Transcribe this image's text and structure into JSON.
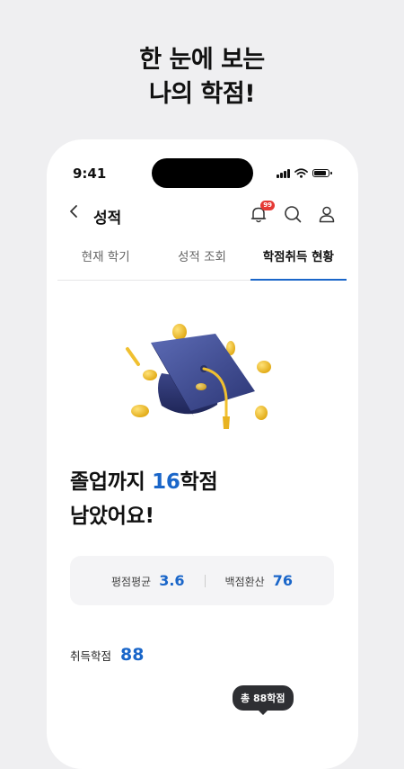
{
  "promo": {
    "line1": "한 눈에 보는",
    "line2": "나의 학점!"
  },
  "status_bar": {
    "time": "9:41"
  },
  "header": {
    "back_icon": "chevron-left-icon",
    "title": "성적",
    "notification_count": "99"
  },
  "tabs": [
    {
      "label": "현재 학기",
      "active": false
    },
    {
      "label": "성적 조회",
      "active": false
    },
    {
      "label": "학점취득 현황",
      "active": true
    }
  ],
  "headline": {
    "prefix": "졸업까지 ",
    "credits": "16",
    "suffix": "학점",
    "line2": "남았어요!"
  },
  "summary": {
    "gpa_label": "평점평균",
    "gpa_value": "3.6",
    "score_label": "백점환산",
    "score_value": "76"
  },
  "earned": {
    "label": "취득학점",
    "value": "88"
  },
  "tooltip": {
    "text": "총 88학점"
  },
  "colors": {
    "accent": "#1a66c9",
    "badge": "#e53935",
    "coin": "#f5c531",
    "cap": "#3c4a8c"
  }
}
